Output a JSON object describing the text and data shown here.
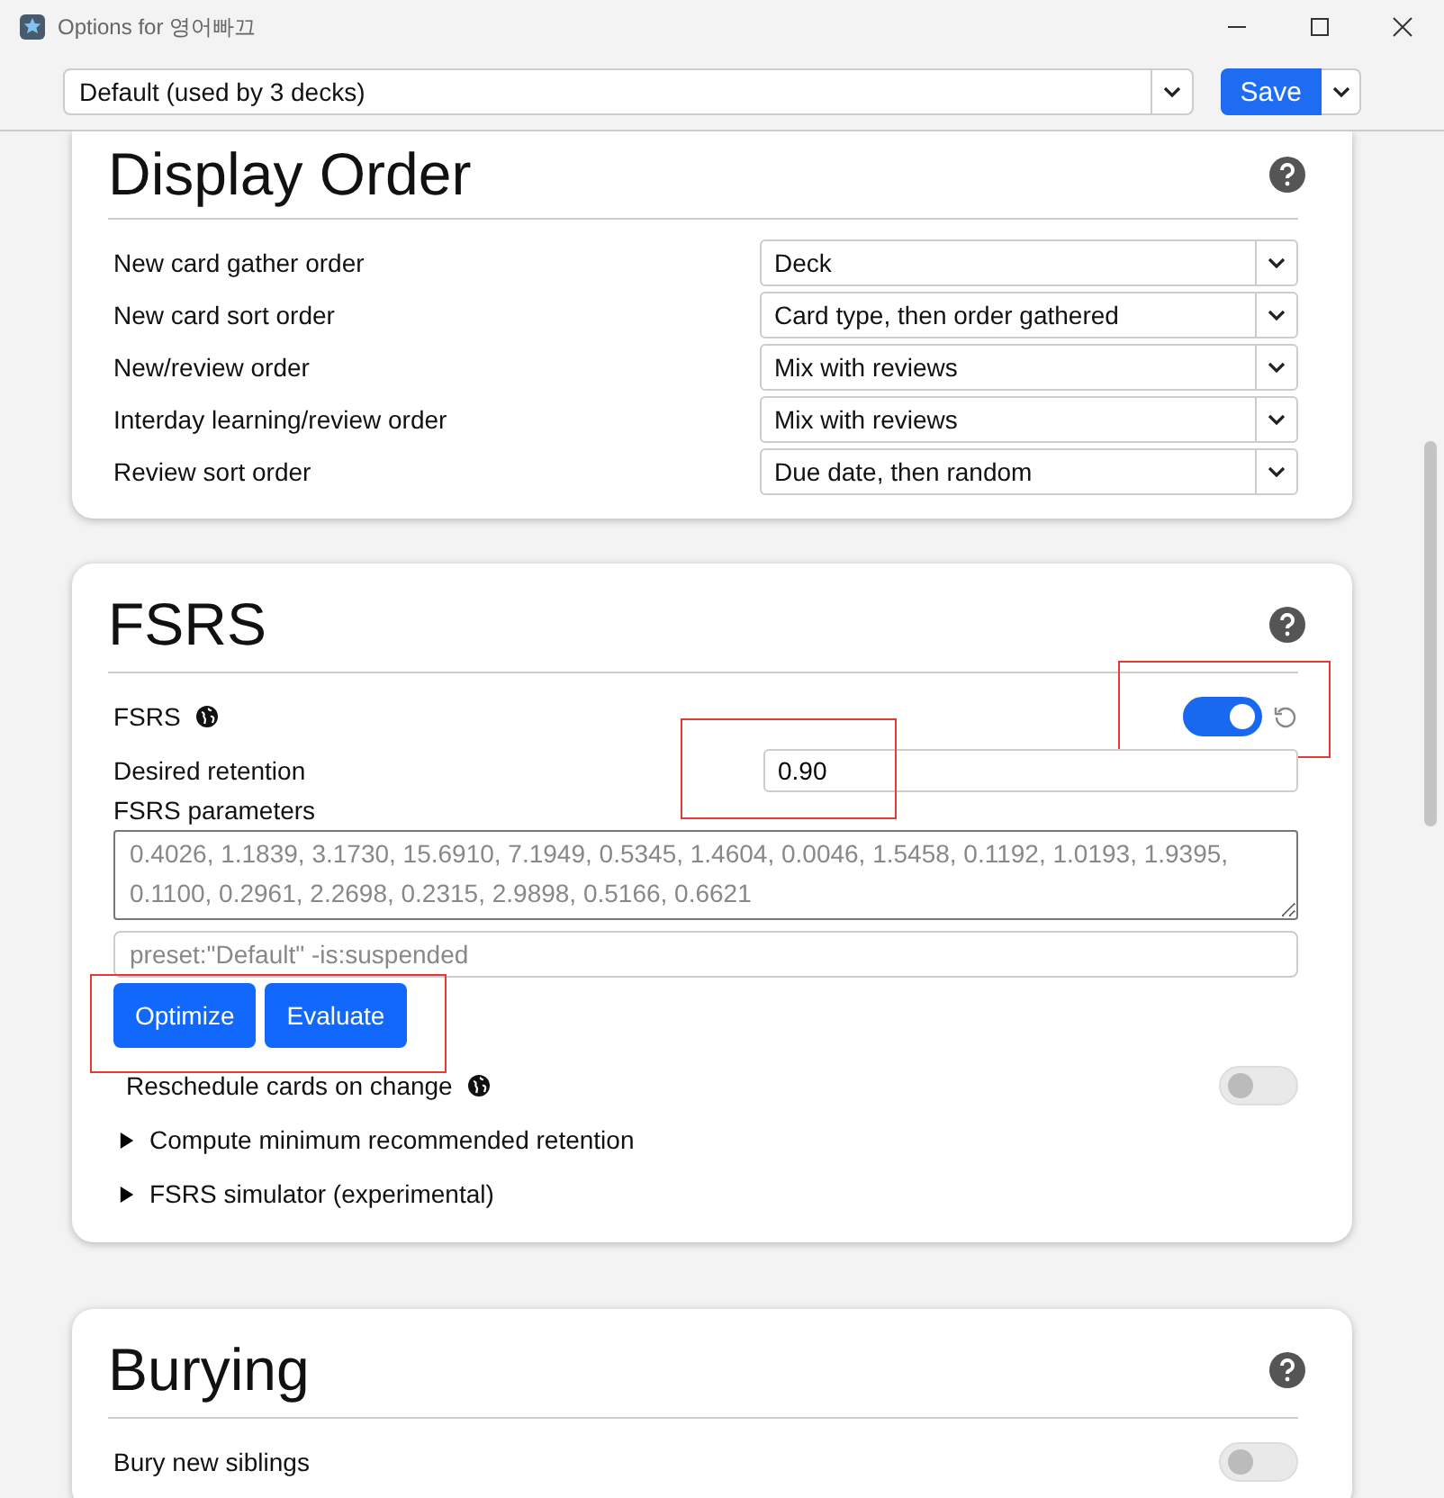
{
  "window": {
    "title": "Options for 영어빠끄"
  },
  "toolbar": {
    "preset": "Default (used by 3 decks)",
    "save_label": "Save"
  },
  "sections": [
    {
      "title": "Display Order",
      "rows": [
        {
          "kind": "select",
          "label": "New card gather order",
          "value": "Deck"
        },
        {
          "kind": "select",
          "label": "New card sort order",
          "value": "Card type, then order gathered"
        },
        {
          "kind": "select",
          "label": "New/review order",
          "value": "Mix with reviews"
        },
        {
          "kind": "select",
          "label": "Interday learning/review order",
          "value": "Mix with reviews"
        },
        {
          "kind": "select",
          "label": "Review sort order",
          "value": "Due date, then random"
        }
      ]
    },
    {
      "title": "FSRS",
      "rows": [
        {
          "kind": "toggle",
          "label": "FSRS",
          "on": true,
          "global": true,
          "revertable": true,
          "highlight": true
        },
        {
          "kind": "input",
          "label": "Desired retention",
          "value": "0.90",
          "highlight": true
        },
        {
          "kind": "textarea",
          "label": "FSRS parameters",
          "placeholder": "0.4026, 1.1839, 3.1730, 15.6910, 7.1949, 0.5345, 1.4604, 0.0046, 1.5458, 0.1192, 1.0193, 1.9395, 0.1100, 0.2961, 2.2698, 0.2315, 2.9898, 0.5166, 0.6621"
        },
        {
          "kind": "search",
          "placeholder": "preset:\"Default\" -is:suspended"
        },
        {
          "kind": "buttons",
          "labels": [
            "Optimize",
            "Evaluate"
          ],
          "highlight": true
        },
        {
          "kind": "toggle",
          "label": "Reschedule cards on change",
          "on": false,
          "global": true,
          "revertable": false,
          "highlight": false,
          "indent": true
        },
        {
          "kind": "details",
          "label": "Compute minimum recommended retention",
          "expanded": false
        },
        {
          "kind": "details",
          "label": "FSRS simulator (experimental)",
          "expanded": false
        }
      ]
    },
    {
      "title": "Burying",
      "rows": [
        {
          "kind": "toggle",
          "label": "Bury new siblings",
          "on": false,
          "global": false,
          "revertable": false,
          "highlight": false
        }
      ]
    }
  ]
}
